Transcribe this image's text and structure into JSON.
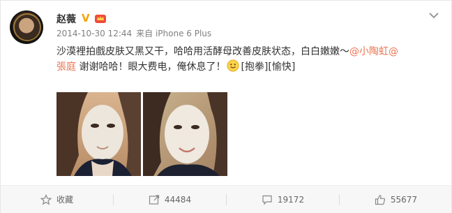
{
  "user": {
    "name": "赵薇",
    "verified_badge": "V"
  },
  "meta": {
    "time": "2014-10-30 12:44",
    "source": "来自 iPhone 6 Plus"
  },
  "post": {
    "line1_text": "沙漠裡拍戲皮肤又黑又干，哈哈用活酵母改善皮肤状态，白白嫩嫩～",
    "mention1": "@小陶虹",
    "mention2_prefix": "@",
    "mention2": "張庭",
    "line2_text": " 谢谢哈哈！眼大费电，俺休息了！",
    "tag1": "[抱拳]",
    "tag2": "[愉快]"
  },
  "actions": {
    "favorite": "收藏",
    "repost_count": "44484",
    "comment_count": "19172",
    "like_count": "55677"
  },
  "colors": {
    "mention": "#eb7350",
    "badge": "#f5a30a"
  }
}
